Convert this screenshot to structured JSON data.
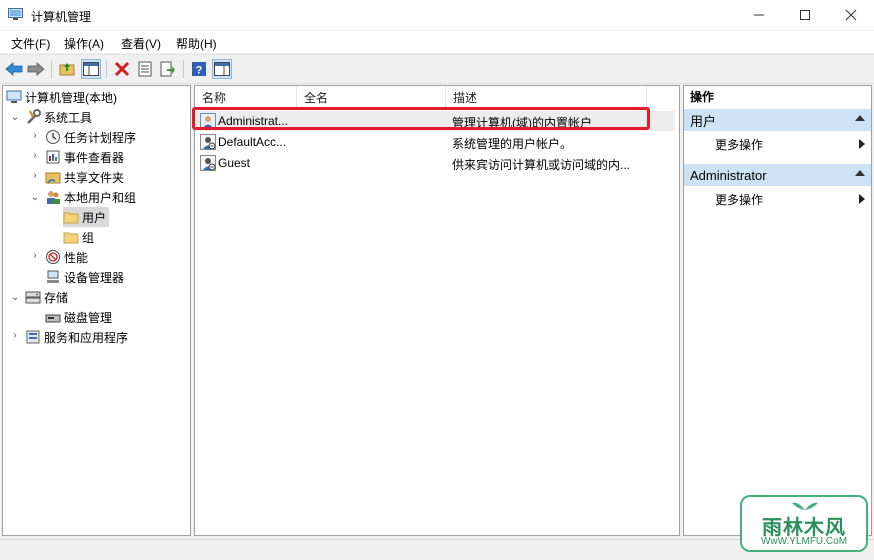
{
  "window": {
    "title": "计算机管理",
    "min_icon": "minimize-icon",
    "max_icon": "maximize-icon",
    "close_icon": "close-icon"
  },
  "menu": {
    "file": "文件(F)",
    "action": "操作(A)",
    "view": "查看(V)",
    "help": "帮助(H)"
  },
  "toolbar": {
    "icons": [
      "back-icon",
      "forward-icon",
      "up-folder-icon",
      "show-hide-tree-icon",
      "delete-icon",
      "properties-icon",
      "export-icon",
      "help-icon",
      "show-action-pane-icon"
    ]
  },
  "tree": {
    "root": "计算机管理(本地)",
    "system_tools": "系统工具",
    "task_scheduler": "任务计划程序",
    "event_viewer": "事件查看器",
    "shared_folders": "共享文件夹",
    "local_users": "本地用户和组",
    "users": "用户",
    "groups": "组",
    "performance": "性能",
    "device_manager": "设备管理器",
    "storage": "存储",
    "disk_management": "磁盘管理",
    "services_apps": "服务和应用程序"
  },
  "list": {
    "columns": {
      "name": "名称",
      "fullname": "全名",
      "description": "描述"
    },
    "rows": [
      {
        "name": "Administrat...",
        "fullname": "",
        "description": "管理计算机(域)的内置帐户"
      },
      {
        "name": "DefaultAcc...",
        "fullname": "",
        "description": "系统管理的用户帐户。"
      },
      {
        "name": "Guest",
        "fullname": "",
        "description": "供来宾访问计算机或访问域的内..."
      }
    ]
  },
  "actions": {
    "header": "操作",
    "section1": "用户",
    "more1": "更多操作",
    "section2": "Administrator",
    "more2": "更多操作"
  },
  "colors": {
    "accent_selection": "#cde3f5",
    "highlight_box": "#e41b2c",
    "watermark": "#42b07e"
  },
  "watermark": {
    "brand": "雨林木风",
    "url": "WwW.YLMFU.CoM"
  }
}
